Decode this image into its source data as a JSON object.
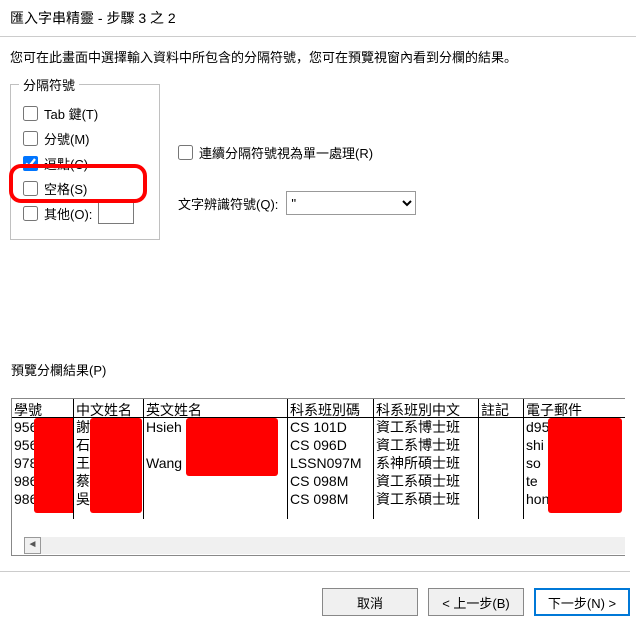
{
  "title": "匯入字串精靈 - 步驟 3 之 2",
  "instruction": "您可在此畫面中選擇輸入資料中所包含的分隔符號，您可在預覽視窗內看到分欄的結果。",
  "delimiters": {
    "legend": "分隔符號",
    "tab": "Tab 鍵(T)",
    "semicolon": "分號(M)",
    "comma": "逗點(C)",
    "space": "空格(S)",
    "other": "其他(O):"
  },
  "consecutive": "連續分隔符號視為單一處理(R)",
  "qualifier_label": "文字辨識符號(Q):",
  "qualifier_value": "\"",
  "preview_label": "預覽分欄結果(P)",
  "columns": {
    "id": "學號",
    "cname": "中文姓名",
    "ename": "英文姓名",
    "code": "科系班別碼",
    "dept": "科系班別中文",
    "note": "註記",
    "email": "電子郵件"
  },
  "rows": [
    {
      "id": "9563563",
      "cn": "謝",
      "en": "Hsieh",
      "code": "CS  101D",
      "dept": "資工系博士班",
      "em": "d95"
    },
    {
      "id": "956",
      "cn": "石",
      "en": "",
      "code": "CS  096D",
      "dept": "資工系博士班",
      "em": "shi"
    },
    {
      "id": "978",
      "cn": "王",
      "en": "Wang",
      "code": "LSSN097M",
      "dept": "系神所碩士班",
      "em": "so"
    },
    {
      "id": "986",
      "cn": "蔡",
      "en": "",
      "code": "CS  098M",
      "dept": "資工系碩士班",
      "em": "te"
    },
    {
      "id": "986",
      "cn": "吳",
      "en": "",
      "code": "CS  098M",
      "dept": "資工系碩士班",
      "em": "hon"
    }
  ],
  "buttons": {
    "cancel": "取消",
    "back": "< 上一步(B)",
    "next": "下一步(N) >"
  }
}
